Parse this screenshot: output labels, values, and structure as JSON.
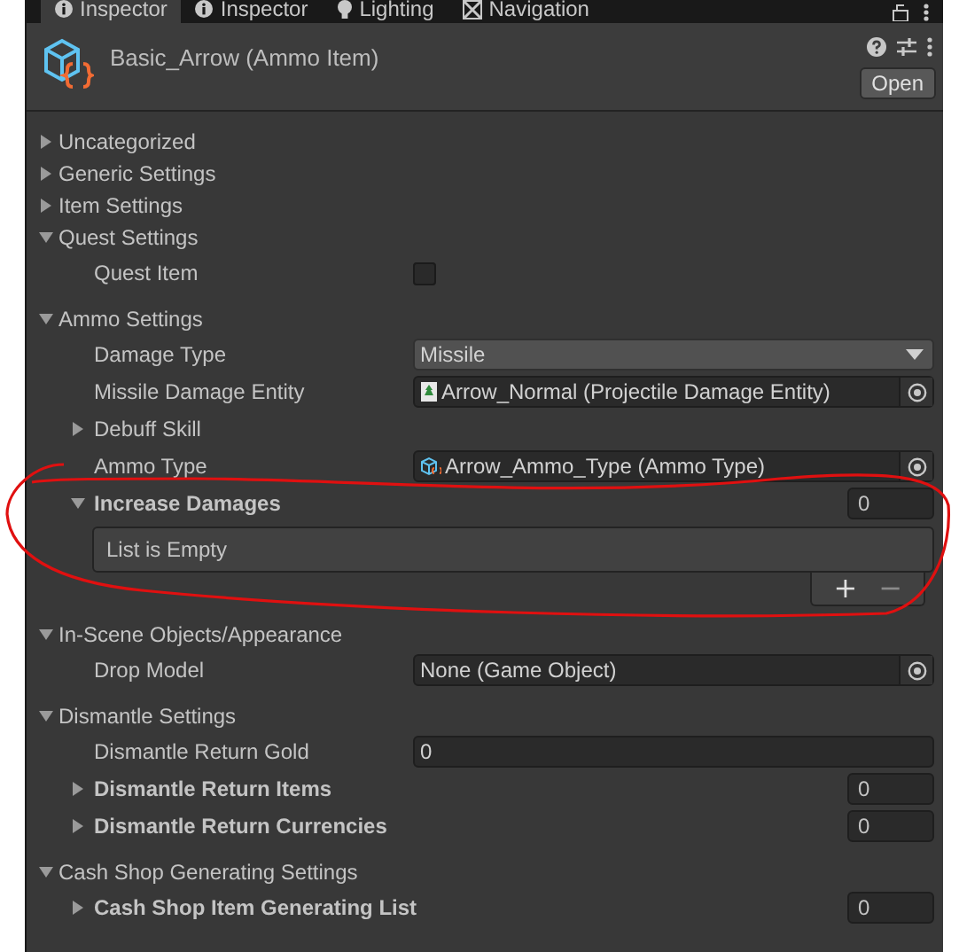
{
  "tabs": [
    {
      "label": "Inspector",
      "kind": "info",
      "selected": true
    },
    {
      "label": "Inspector",
      "kind": "info",
      "selected": false
    },
    {
      "label": "Lighting",
      "kind": "bulb",
      "selected": false
    },
    {
      "label": "Navigation",
      "kind": "nav",
      "selected": false
    }
  ],
  "header": {
    "title": "Basic_Arrow (Ammo Item)",
    "button": "Open"
  },
  "sections": [
    {
      "title": "Uncategorized",
      "expanded": false
    },
    {
      "title": "Generic Settings",
      "expanded": false
    },
    {
      "title": "Item Settings",
      "expanded": false
    },
    {
      "title": "Quest Settings",
      "expanded": true,
      "items": [
        {
          "kind": "checkbox",
          "label": "Quest Item",
          "checked": false
        }
      ]
    },
    {
      "title": "Ammo Settings",
      "expanded": true,
      "items": [
        {
          "kind": "dropdown",
          "label": "Damage Type",
          "value": "Missile"
        },
        {
          "kind": "prefabref",
          "label": "Missile Damage Entity",
          "value": "Arrow_Normal (Projectile Damage Entity)"
        },
        {
          "kind": "foldout",
          "label": "Debuff Skill",
          "expanded": false
        },
        {
          "kind": "assetref",
          "label": "Ammo Type",
          "value": "Arrow_Ammo_Type (Ammo Type)"
        },
        {
          "kind": "list",
          "label": "Increase Damages",
          "expanded": true,
          "count": "0",
          "empty_text": "List is Empty",
          "add": "+",
          "remove": "−"
        }
      ]
    },
    {
      "title": "In-Scene Objects/Appearance",
      "expanded": true,
      "items": [
        {
          "kind": "object",
          "label": "Drop Model",
          "value": "None (Game Object)"
        }
      ]
    },
    {
      "title": "Dismantle Settings",
      "expanded": true,
      "items": [
        {
          "kind": "number",
          "label": "Dismantle Return Gold",
          "value": "0"
        },
        {
          "kind": "list",
          "label": "Dismantle Return Items",
          "expanded": false,
          "count": "0"
        },
        {
          "kind": "list",
          "label": "Dismantle Return Currencies",
          "expanded": false,
          "count": "0"
        }
      ]
    },
    {
      "title": "Cash Shop Generating Settings",
      "expanded": true,
      "items": [
        {
          "kind": "list",
          "label": "Cash Shop Item Generating List",
          "expanded": false,
          "count": "0"
        }
      ]
    }
  ]
}
